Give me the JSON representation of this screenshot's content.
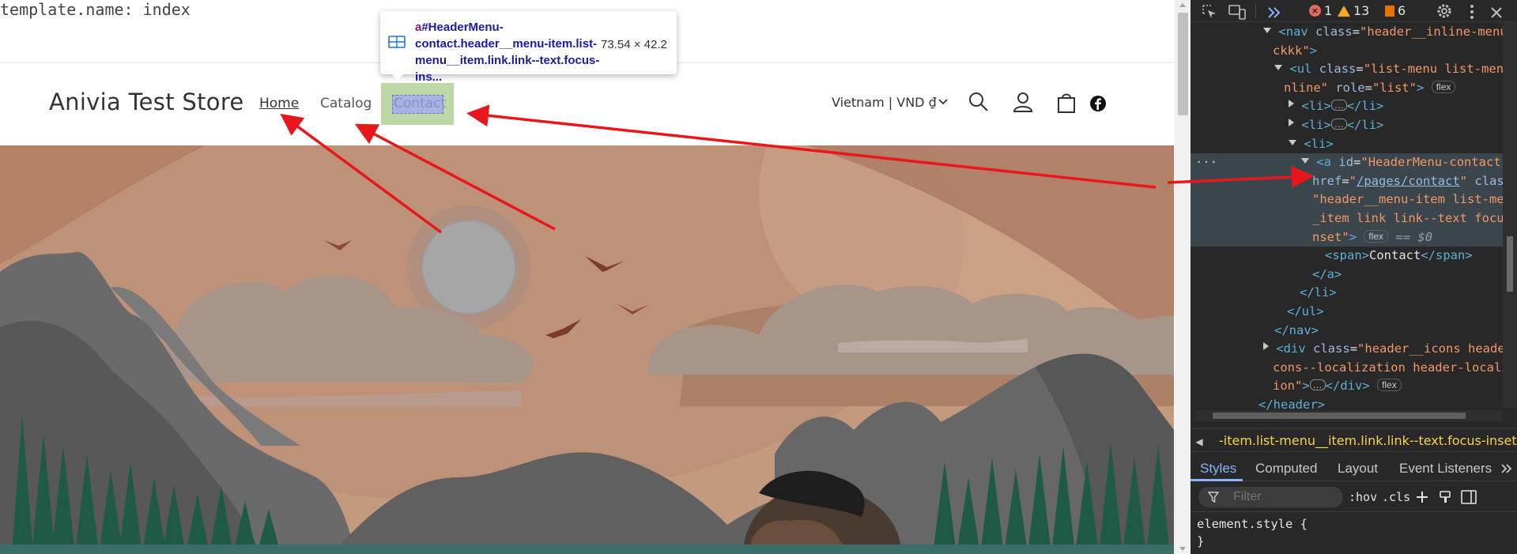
{
  "page": {
    "template_label": "template.name: index",
    "store_name": "Anivia Test Store",
    "nav": [
      "Home",
      "Catalog",
      "Contact"
    ],
    "locale": "Vietnam | VND ₫"
  },
  "tooltip": {
    "tag": "a",
    "selector": "#HeaderMenu-contact.header__menu-item.list-menu__item.link.link--text.focus-ins...",
    "size": "73.54 × 42.2"
  },
  "devtools": {
    "badges": {
      "errors": "1",
      "warnings": "13",
      "issues": "6"
    },
    "dom": {
      "l1_tag": "nav",
      "l1_attr": "class",
      "l1_val": "\"header__inline-menu",
      "l2_val": "ckkk\"",
      "l3_tag": "ul",
      "l3_attr": "class",
      "l3_val": "\"list-menu list-menu",
      "l4_val": "nline\"",
      "l4_attr": "role",
      "l4_val2": "\"list\"",
      "li": "li",
      "a_attr_id": "id",
      "a_id_val": "\"HeaderMenu-contact\"",
      "href_attr": "href",
      "href_val": "/pages/contact",
      "class_attr": "class",
      "class_val1": "\"header__menu-item list-men",
      "class_val2": "_item link link--text focus",
      "class_val3": "nset\"",
      "eq": "== $0",
      "span_text": "Contact",
      "div_attr": "class",
      "div_val1": "\"header__icons header",
      "div_val2": "cons--localization header-locali",
      "div_val3": "ion\"",
      "header": "header",
      "pill_flex": "flex",
      "ellipsis": "…"
    },
    "breadcrumb": "-item.list-menu__item.link.link--text.focus-inset",
    "tabs": [
      "Styles",
      "Computed",
      "Layout",
      "Event Listeners"
    ],
    "filter_placeholder": "Filter",
    "hov": ":hov",
    "cls": ".cls",
    "style_line1": "element.style {",
    "style_line2": "}"
  },
  "colors": {
    "arrow": "#e8171c",
    "hero_sky": "#c49a7e",
    "link_blue": "#8ab4f8"
  }
}
